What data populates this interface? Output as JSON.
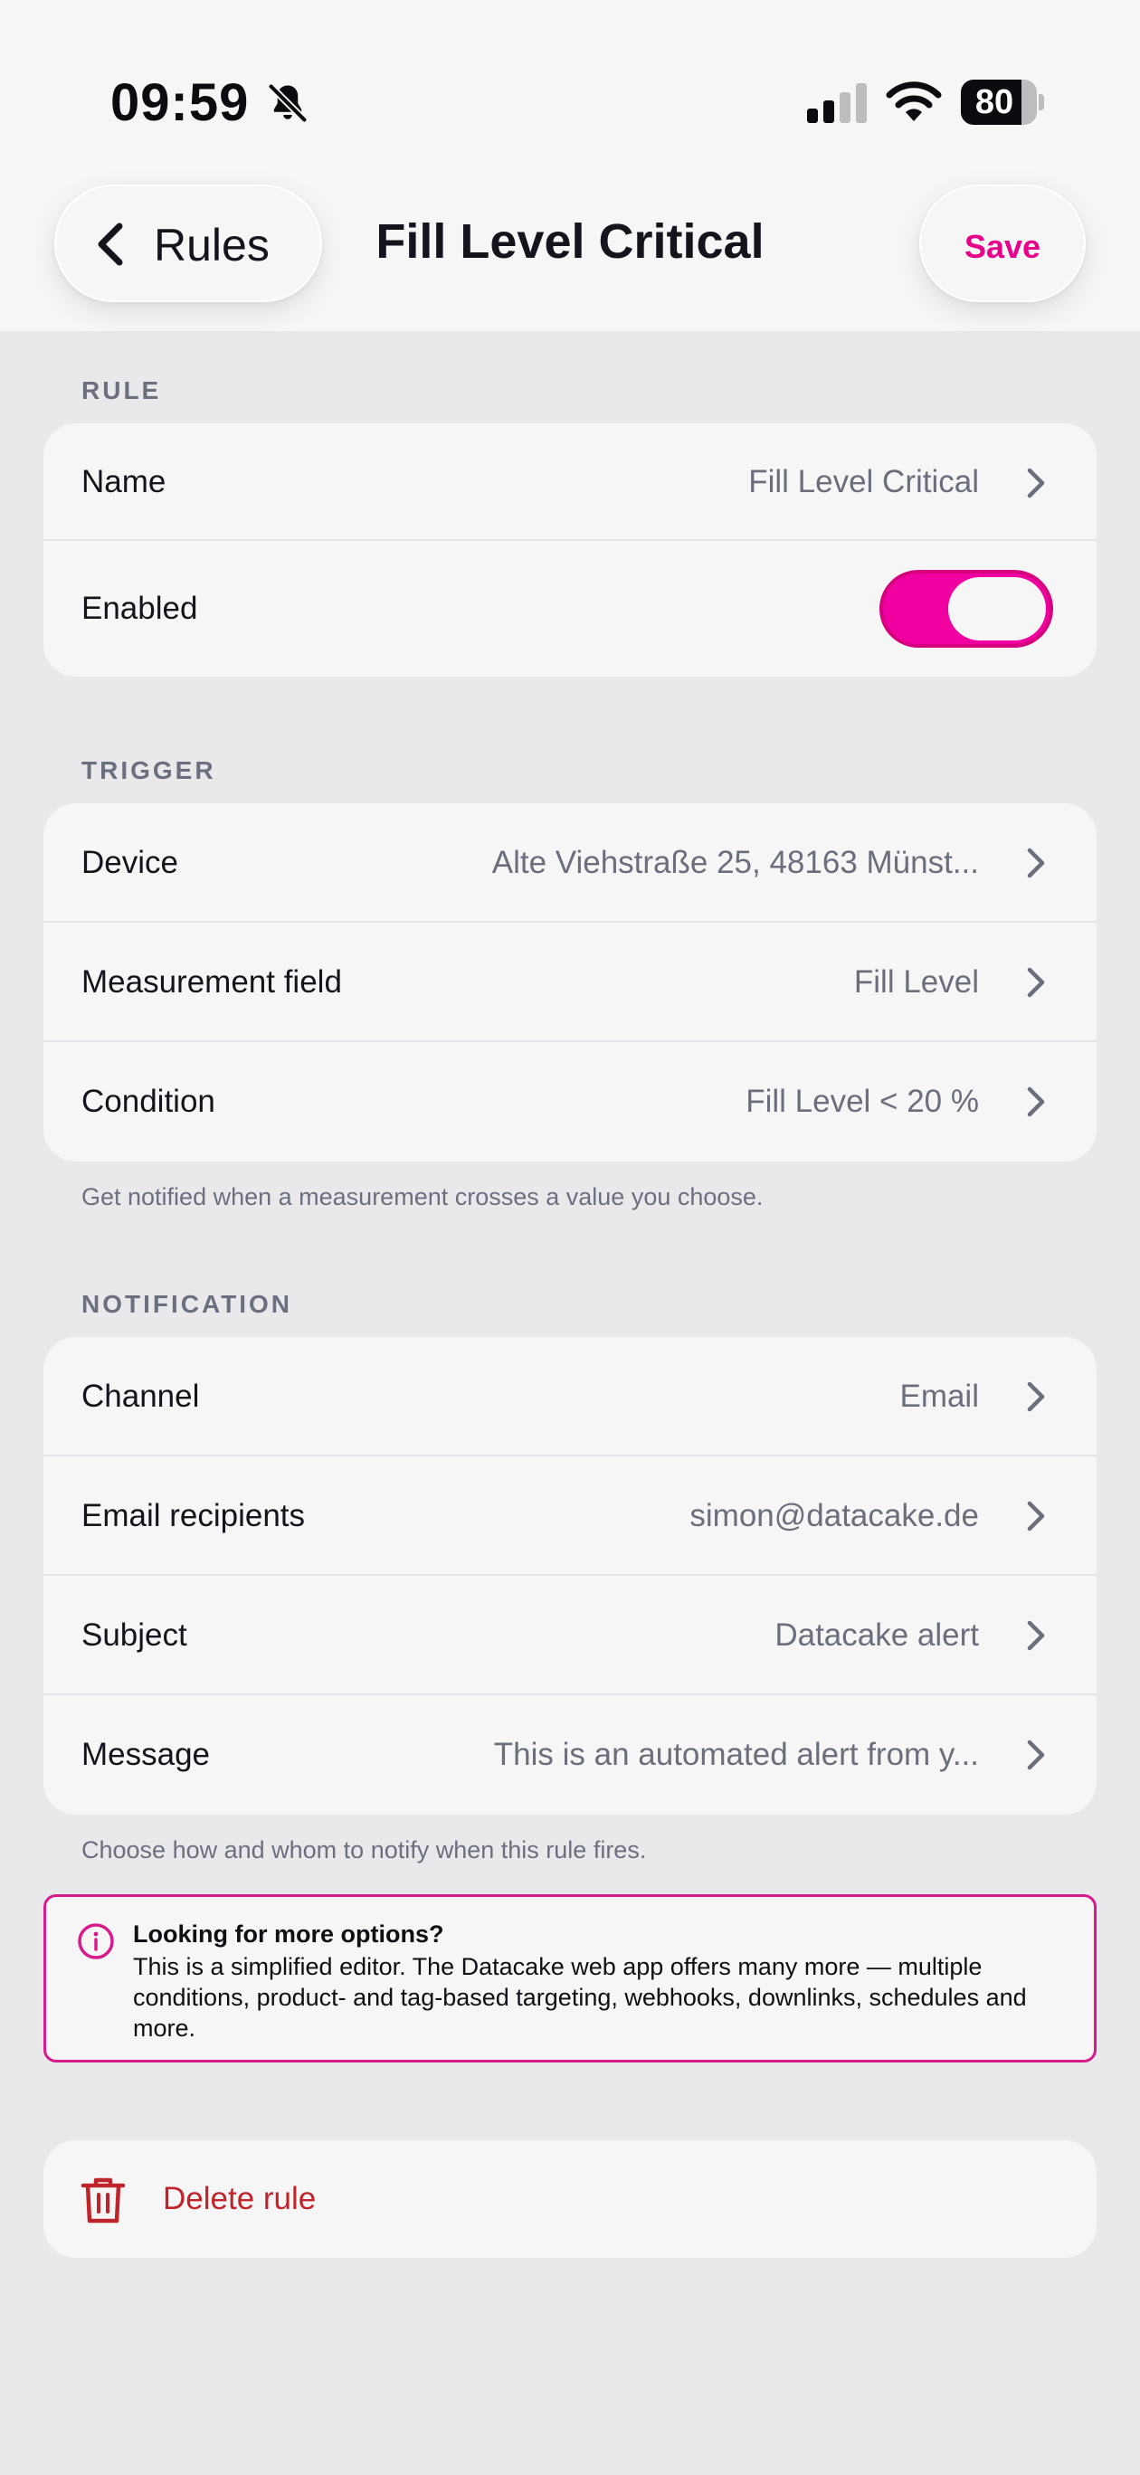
{
  "status_bar": {
    "time": "09:59",
    "battery": "80",
    "battery_level": 0.8,
    "icons": [
      "bell-slash-icon",
      "signal-icon",
      "wifi-icon",
      "battery-icon"
    ]
  },
  "header": {
    "back_label": "Rules",
    "title": "Fill Level Critical",
    "save_label": "Save"
  },
  "rule": {
    "section_label": "RULE",
    "name_label": "Name",
    "name_value": "Fill Level Critical",
    "enabled_label": "Enabled",
    "enabled": true
  },
  "trigger": {
    "section_label": "TRIGGER",
    "device_label": "Device",
    "device_value": "Alte Viehstraße 25, 48163 Münst...",
    "field_label": "Measurement field",
    "field_value": "Fill Level",
    "condition_label": "Condition",
    "condition_value": "Fill Level < 20 %",
    "footnote": "Get notified when a measurement crosses a value you choose."
  },
  "notification": {
    "section_label": "NOTIFICATION",
    "channel_label": "Channel",
    "channel_value": "Email",
    "recipients_label": "Email recipients",
    "recipients_value": "simon@datacake.de",
    "subject_label": "Subject",
    "subject_value": "Datacake alert",
    "message_label": "Message",
    "message_value": "This is an automated alert from y...",
    "footnote": "Choose how and whom to notify when this rule fires."
  },
  "info": {
    "title": "Looking for more options?",
    "body": "This is a simplified editor. The Datacake web app offers many more — multiple conditions, product- and tag-based targeting, webhooks, downlinks, schedules and more."
  },
  "delete": {
    "label": "Delete rule"
  },
  "colors": {
    "accent": "#e6008a",
    "toggle_on": "#f000a0",
    "danger": "#c0242b",
    "background": "#e9e9ec",
    "card": "#f6f6f7",
    "secondary_text": "#6b6e7b"
  }
}
